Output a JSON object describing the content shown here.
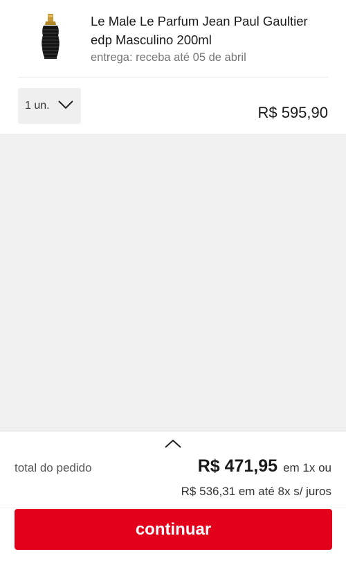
{
  "product": {
    "title": "Le Male Le Parfum Jean Paul Gaultier edp Masculino 200ml",
    "delivery": "entrega: receba até 05 de abril",
    "quantity_label": "1 un.",
    "price": "R$ 595,90",
    "image_icon": "perfume-bottle-icon"
  },
  "summary": {
    "total_label": "total do pedido",
    "total_value": "R$ 471,95",
    "total_suffix": "em 1x ou",
    "installments": "R$ 536,31 em até 8x s/ juros",
    "expand_icon": "chevron-up-icon"
  },
  "actions": {
    "continue_label": "continuar"
  },
  "colors": {
    "accent": "#e3001b",
    "background_gray": "#f0f0f0"
  }
}
